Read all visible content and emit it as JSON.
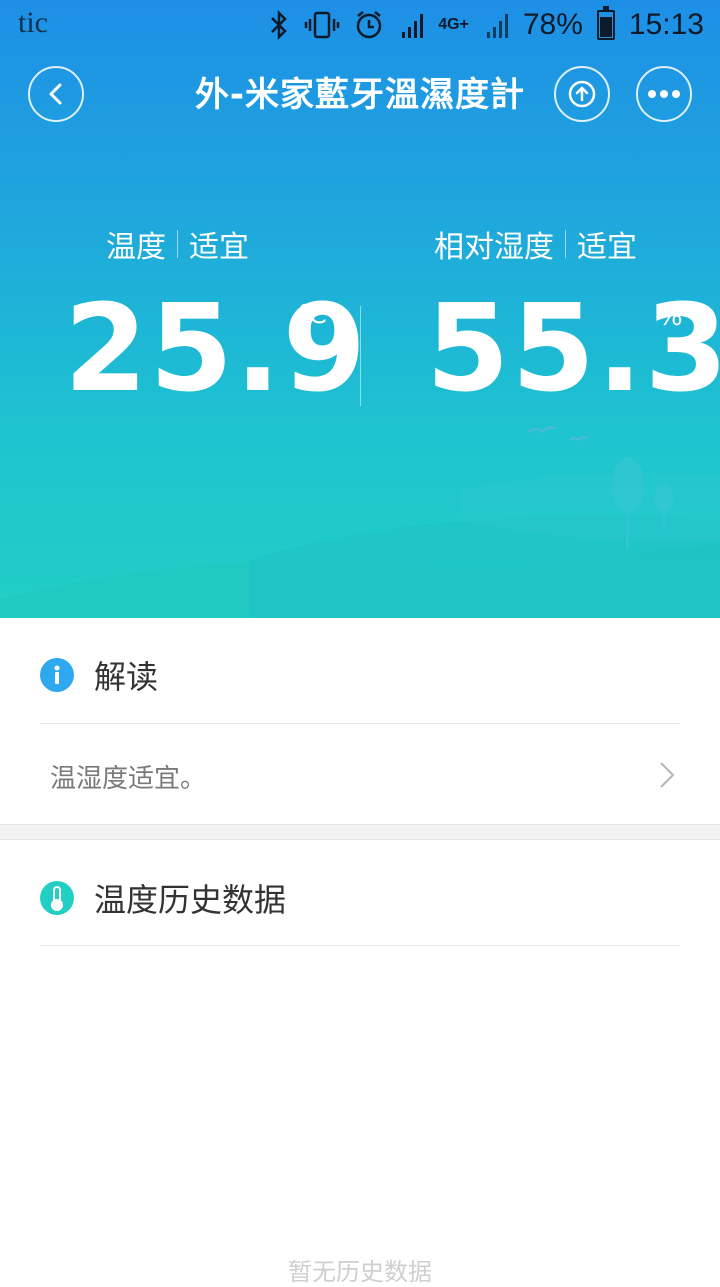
{
  "status_bar": {
    "app_text": "tic",
    "network_label": "4G+",
    "battery": "78%",
    "time": "15:13",
    "battery_level": 0.78
  },
  "header": {
    "title": "外-米家藍牙溫濕度計",
    "back_icon": "chevron-left-icon",
    "share_icon": "upload-icon",
    "more_icon": "more-dots-icon"
  },
  "temperature": {
    "label": "温度",
    "status": "适宜",
    "value": "25.9",
    "unit": "℃"
  },
  "humidity": {
    "label": "相对湿度",
    "status": "适宜",
    "value": "55.3",
    "unit": "%"
  },
  "interpretation": {
    "title": "解读",
    "icon": "info-icon",
    "icon_color": "#2ea8ee",
    "text": "温湿度适宜。"
  },
  "history": {
    "title": "温度历史数据",
    "icon": "thermometer-icon",
    "icon_color": "#22cfc5",
    "empty_text": "暂无历史数据"
  }
}
